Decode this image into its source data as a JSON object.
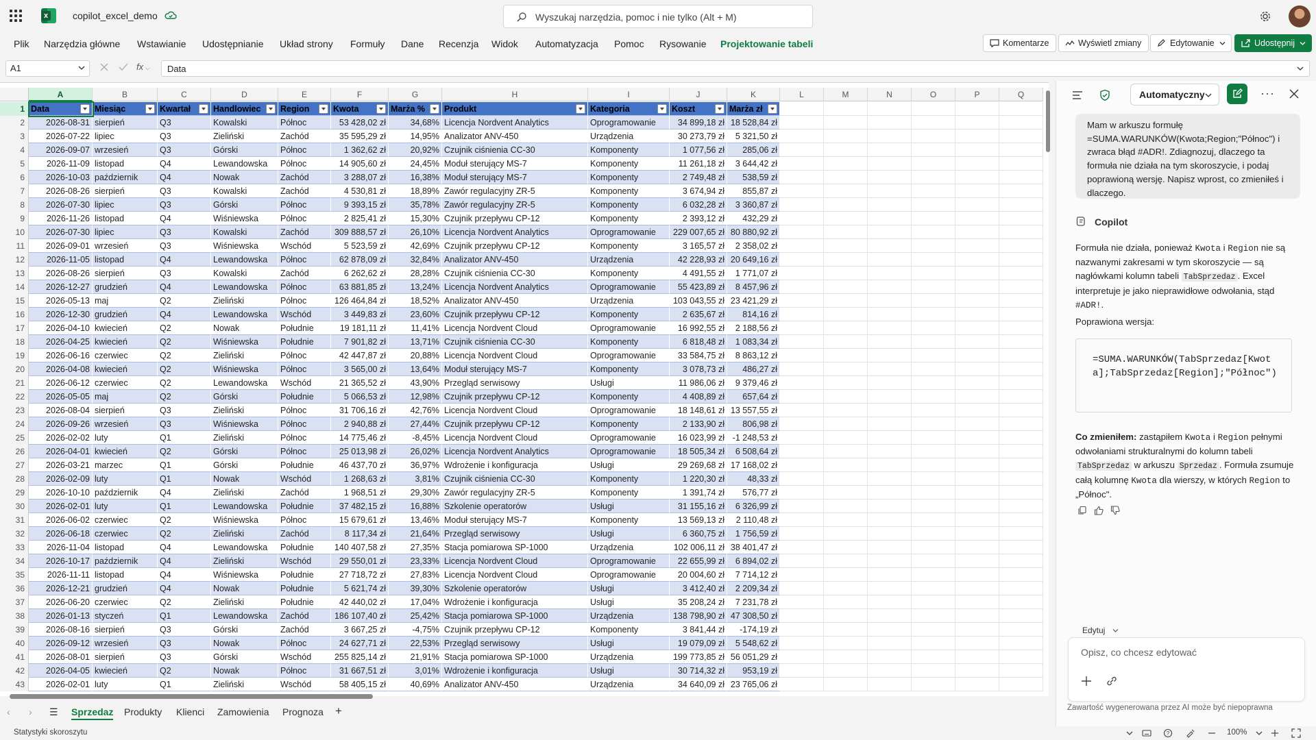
{
  "title_bar": {
    "doc_title": "copilot_excel_demo",
    "search_placeholder": "Wyszukaj narzędzia, pomoc i nie tylko (Alt + M)"
  },
  "ribbon": {
    "tabs": [
      "Plik",
      "Narzędzia główne",
      "Wstawianie",
      "Udostępnianie",
      "Układ strony",
      "Formuły",
      "Dane",
      "Recenzja",
      "Widok",
      "Automatyzacja",
      "Pomoc",
      "Rysowanie",
      "Projektowanie tabeli"
    ],
    "active_tab": "Projektowanie tabeli",
    "comments_label": "Komentarze",
    "show_changes_label": "Wyświetl zmiany",
    "editing_label": "Edytowanie",
    "share_label": "Udostępnij"
  },
  "formula_bar": {
    "name_box": "A1",
    "fx": "fx",
    "formula": "Data"
  },
  "grid": {
    "columns": [
      "A",
      "B",
      "C",
      "D",
      "E",
      "F",
      "G",
      "H",
      "I",
      "J",
      "K",
      "L",
      "M",
      "N",
      "O",
      "P",
      "Q"
    ],
    "table_headers": [
      "Data",
      "Miesiąc",
      "Kwartał",
      "Handlowiec",
      "Region",
      "Kwota",
      "Marża %",
      "Produkt",
      "Kategoria",
      "Koszt",
      "Marża zł"
    ],
    "rows": [
      [
        "2026-08-31",
        "sierpień",
        "Q3",
        "Kowalski",
        "Północ",
        "53 428,02 zł",
        "34,68%",
        "Licencja Nordvent Analytics",
        "Oprogramowanie",
        "34 899,18 zł",
        "18 528,84 zł"
      ],
      [
        "2026-07-22",
        "lipiec",
        "Q3",
        "Zieliński",
        "Zachód",
        "35 595,29 zł",
        "14,95%",
        "Analizator ANV-450",
        "Urządzenia",
        "30 273,79 zł",
        "5 321,50 zł"
      ],
      [
        "2026-09-07",
        "wrzesień",
        "Q3",
        "Górski",
        "Północ",
        "1 362,62 zł",
        "20,92%",
        "Czujnik ciśnienia CC-30",
        "Komponenty",
        "1 077,56 zł",
        "285,06 zł"
      ],
      [
        "2026-11-09",
        "listopad",
        "Q4",
        "Lewandowska",
        "Północ",
        "14 905,60 zł",
        "24,45%",
        "Moduł sterujący MS-7",
        "Komponenty",
        "11 261,18 zł",
        "3 644,42 zł"
      ],
      [
        "2026-10-03",
        "październik",
        "Q4",
        "Nowak",
        "Zachód",
        "3 288,07 zł",
        "16,38%",
        "Moduł sterujący MS-7",
        "Komponenty",
        "2 749,48 zł",
        "538,59 zł"
      ],
      [
        "2026-08-26",
        "sierpień",
        "Q3",
        "Kowalski",
        "Zachód",
        "4 530,81 zł",
        "18,89%",
        "Zawór regulacyjny ZR-5",
        "Komponenty",
        "3 674,94 zł",
        "855,87 zł"
      ],
      [
        "2026-07-30",
        "lipiec",
        "Q3",
        "Górski",
        "Północ",
        "9 393,15 zł",
        "35,78%",
        "Zawór regulacyjny ZR-5",
        "Komponenty",
        "6 032,28 zł",
        "3 360,87 zł"
      ],
      [
        "2026-11-26",
        "listopad",
        "Q4",
        "Wiśniewska",
        "Północ",
        "2 825,41 zł",
        "15,30%",
        "Czujnik przepływu CP-12",
        "Komponenty",
        "2 393,12 zł",
        "432,29 zł"
      ],
      [
        "2026-07-30",
        "lipiec",
        "Q3",
        "Kowalski",
        "Zachód",
        "309 888,57 zł",
        "26,10%",
        "Licencja Nordvent Analytics",
        "Oprogramowanie",
        "229 007,65 zł",
        "80 880,92 zł"
      ],
      [
        "2026-09-01",
        "wrzesień",
        "Q3",
        "Wiśniewska",
        "Wschód",
        "5 523,59 zł",
        "42,69%",
        "Czujnik przepływu CP-12",
        "Komponenty",
        "3 165,57 zł",
        "2 358,02 zł"
      ],
      [
        "2026-11-05",
        "listopad",
        "Q4",
        "Lewandowska",
        "Północ",
        "62 878,09 zł",
        "32,84%",
        "Analizator ANV-450",
        "Urządzenia",
        "42 228,93 zł",
        "20 649,16 zł"
      ],
      [
        "2026-08-26",
        "sierpień",
        "Q3",
        "Kowalski",
        "Zachód",
        "6 262,62 zł",
        "28,28%",
        "Czujnik ciśnienia CC-30",
        "Komponenty",
        "4 491,55 zł",
        "1 771,07 zł"
      ],
      [
        "2026-12-27",
        "grudzień",
        "Q4",
        "Lewandowska",
        "Północ",
        "63 881,85 zł",
        "13,24%",
        "Licencja Nordvent Analytics",
        "Oprogramowanie",
        "55 423,89 zł",
        "8 457,96 zł"
      ],
      [
        "2026-05-13",
        "maj",
        "Q2",
        "Zieliński",
        "Północ",
        "126 464,84 zł",
        "18,52%",
        "Analizator ANV-450",
        "Urządzenia",
        "103 043,55 zł",
        "23 421,29 zł"
      ],
      [
        "2026-12-30",
        "grudzień",
        "Q4",
        "Lewandowska",
        "Wschód",
        "3 449,83 zł",
        "23,60%",
        "Czujnik przepływu CP-12",
        "Komponenty",
        "2 635,67 zł",
        "814,16 zł"
      ],
      [
        "2026-04-10",
        "kwiecień",
        "Q2",
        "Nowak",
        "Południe",
        "19 181,11 zł",
        "11,41%",
        "Licencja Nordvent Cloud",
        "Oprogramowanie",
        "16 992,55 zł",
        "2 188,56 zł"
      ],
      [
        "2026-04-25",
        "kwiecień",
        "Q2",
        "Wiśniewska",
        "Południe",
        "7 901,82 zł",
        "13,71%",
        "Czujnik ciśnienia CC-30",
        "Komponenty",
        "6 818,48 zł",
        "1 083,34 zł"
      ],
      [
        "2026-06-16",
        "czerwiec",
        "Q2",
        "Zieliński",
        "Północ",
        "42 447,87 zł",
        "20,88%",
        "Licencja Nordvent Cloud",
        "Oprogramowanie",
        "33 584,75 zł",
        "8 863,12 zł"
      ],
      [
        "2026-04-08",
        "kwiecień",
        "Q2",
        "Wiśniewska",
        "Północ",
        "3 565,00 zł",
        "13,64%",
        "Moduł sterujący MS-7",
        "Komponenty",
        "3 078,73 zł",
        "486,27 zł"
      ],
      [
        "2026-06-12",
        "czerwiec",
        "Q2",
        "Lewandowska",
        "Wschód",
        "21 365,52 zł",
        "43,90%",
        "Przegląd serwisowy",
        "Usługi",
        "11 986,06 zł",
        "9 379,46 zł"
      ],
      [
        "2026-05-05",
        "maj",
        "Q2",
        "Górski",
        "Południe",
        "5 066,53 zł",
        "12,98%",
        "Czujnik przepływu CP-12",
        "Komponenty",
        "4 408,89 zł",
        "657,64 zł"
      ],
      [
        "2026-08-04",
        "sierpień",
        "Q3",
        "Zieliński",
        "Północ",
        "31 706,16 zł",
        "42,76%",
        "Licencja Nordvent Cloud",
        "Oprogramowanie",
        "18 148,61 zł",
        "13 557,55 zł"
      ],
      [
        "2026-09-26",
        "wrzesień",
        "Q3",
        "Wiśniewska",
        "Północ",
        "2 940,88 zł",
        "27,44%",
        "Czujnik przepływu CP-12",
        "Komponenty",
        "2 133,90 zł",
        "806,98 zł"
      ],
      [
        "2026-02-02",
        "luty",
        "Q1",
        "Zieliński",
        "Północ",
        "14 775,46 zł",
        "-8,45%",
        "Licencja Nordvent Cloud",
        "Oprogramowanie",
        "16 023,99 zł",
        "-1 248,53 zł"
      ],
      [
        "2026-04-01",
        "kwiecień",
        "Q2",
        "Górski",
        "Północ",
        "25 013,98 zł",
        "26,02%",
        "Licencja Nordvent Analytics",
        "Oprogramowanie",
        "18 505,34 zł",
        "6 508,64 zł"
      ],
      [
        "2026-03-21",
        "marzec",
        "Q1",
        "Górski",
        "Południe",
        "46 437,70 zł",
        "36,97%",
        "Wdrożenie i konfiguracja",
        "Usługi",
        "29 269,68 zł",
        "17 168,02 zł"
      ],
      [
        "2026-02-09",
        "luty",
        "Q1",
        "Nowak",
        "Wschód",
        "1 268,63 zł",
        "3,81%",
        "Czujnik ciśnienia CC-30",
        "Komponenty",
        "1 220,30 zł",
        "48,33 zł"
      ],
      [
        "2026-10-10",
        "październik",
        "Q4",
        "Zieliński",
        "Zachód",
        "1 968,51 zł",
        "29,30%",
        "Zawór regulacyjny ZR-5",
        "Komponenty",
        "1 391,74 zł",
        "576,77 zł"
      ],
      [
        "2026-02-01",
        "luty",
        "Q1",
        "Lewandowska",
        "Południe",
        "37 482,15 zł",
        "16,88%",
        "Szkolenie operatorów",
        "Usługi",
        "31 155,16 zł",
        "6 326,99 zł"
      ],
      [
        "2026-06-02",
        "czerwiec",
        "Q2",
        "Wiśniewska",
        "Północ",
        "15 679,61 zł",
        "13,46%",
        "Moduł sterujący MS-7",
        "Komponenty",
        "13 569,13 zł",
        "2 110,48 zł"
      ],
      [
        "2026-06-18",
        "czerwiec",
        "Q2",
        "Zieliński",
        "Zachód",
        "8 117,34 zł",
        "21,64%",
        "Przegląd serwisowy",
        "Usługi",
        "6 360,75 zł",
        "1 756,59 zł"
      ],
      [
        "2026-11-04",
        "listopad",
        "Q4",
        "Lewandowska",
        "Południe",
        "140 407,58 zł",
        "27,35%",
        "Stacja pomiarowa SP-1000",
        "Urządzenia",
        "102 006,11 zł",
        "38 401,47 zł"
      ],
      [
        "2026-10-17",
        "październik",
        "Q4",
        "Zieliński",
        "Wschód",
        "29 550,01 zł",
        "23,33%",
        "Licencja Nordvent Cloud",
        "Oprogramowanie",
        "22 655,99 zł",
        "6 894,02 zł"
      ],
      [
        "2026-11-11",
        "listopad",
        "Q4",
        "Wiśniewska",
        "Południe",
        "27 718,72 zł",
        "27,83%",
        "Licencja Nordvent Cloud",
        "Oprogramowanie",
        "20 004,60 zł",
        "7 714,12 zł"
      ],
      [
        "2026-12-21",
        "grudzień",
        "Q4",
        "Nowak",
        "Południe",
        "5 621,74 zł",
        "39,30%",
        "Szkolenie operatorów",
        "Usługi",
        "3 412,40 zł",
        "2 209,34 zł"
      ],
      [
        "2026-06-20",
        "czerwiec",
        "Q2",
        "Zieliński",
        "Południe",
        "42 440,02 zł",
        "17,04%",
        "Wdrożenie i konfiguracja",
        "Usługi",
        "35 208,24 zł",
        "7 231,78 zł"
      ],
      [
        "2026-01-13",
        "styczeń",
        "Q1",
        "Lewandowska",
        "Zachód",
        "186 107,40 zł",
        "25,42%",
        "Stacja pomiarowa SP-1000",
        "Urządzenia",
        "138 798,90 zł",
        "47 308,50 zł"
      ],
      [
        "2026-08-16",
        "sierpień",
        "Q3",
        "Górski",
        "Zachód",
        "3 667,25 zł",
        "-4,75%",
        "Czujnik przepływu CP-12",
        "Komponenty",
        "3 841,44 zł",
        "-174,19 zł"
      ],
      [
        "2026-09-12",
        "wrzesień",
        "Q3",
        "Nowak",
        "Północ",
        "24 627,71 zł",
        "22,53%",
        "Przegląd serwisowy",
        "Usługi",
        "19 079,09 zł",
        "5 548,62 zł"
      ],
      [
        "2026-08-01",
        "sierpień",
        "Q3",
        "Górski",
        "Wschód",
        "255 825,14 zł",
        "21,91%",
        "Stacja pomiarowa SP-1000",
        "Urządzenia",
        "199 773,85 zł",
        "56 051,29 zł"
      ],
      [
        "2026-04-05",
        "kwiecień",
        "Q2",
        "Nowak",
        "Północ",
        "31 667,51 zł",
        "3,01%",
        "Wdrożenie i konfiguracja",
        "Usługi",
        "30 714,32 zł",
        "953,19 zł"
      ],
      [
        "2026-02-01",
        "luty",
        "Q1",
        "Zieliński",
        "Wschód",
        "58 405,15 zł",
        "40,69%",
        "Analizator ANV-450",
        "Urządzenia",
        "34 640,09 zł",
        "23 765,06 zł"
      ]
    ]
  },
  "sheet_tabs": {
    "tabs": [
      "Sprzedaz",
      "Produkty",
      "Klienci",
      "Zamowienia",
      "Prognoza"
    ],
    "active": "Sprzedaz"
  },
  "status_bar": {
    "text": "Statystyki skoroszytu",
    "zoom": "100%"
  },
  "copilot": {
    "mode": "Automatyczny",
    "user_message": "Mam w arkuszu formułę =SUMA.WARUNKÓW(Kwota;Region;\"Północ\") i zwraca błąd #ADR!. Zdiagnozuj, dlaczego ta formuła nie działa na tym skoroszycie, i podaj poprawioną wersję. Napisz wprost, co zmieniłeś i dlaczego.",
    "brand": "Copilot",
    "p1": {
      "a": "Formuła nie działa, ponieważ ",
      "k1": "Kwota",
      "b": " i ",
      "k2": "Region",
      "c": " nie są nazwanymi zakresami w tym skoroszycie — są nagłówkami kolumn tabeli ",
      "chip": "TabSprzedaz",
      "d": ". Excel interpretuje je jako nieprawidłowe odwołania, stąd ",
      "k3": "#ADR!",
      "e": "."
    },
    "corrected_label": "Poprawiona wersja:",
    "code": "=SUMA.WARUNKÓW(TabSprzedaz[Kwota];TabSprzedaz[Region];\"Północ\")",
    "p2": {
      "bold": "Co zmieniłem:",
      "a": " zastąpiłem ",
      "k1": "Kwota",
      "b": " i ",
      "k2": "Region",
      "c": " pełnymi odwołaniami strukturalnymi do kolumn tabeli ",
      "chip1": "TabSprzedaz",
      "d": " w arkuszu ",
      "chip2": "Sprzedaz",
      "e": ". Formuła zsumuje całą kolumnę ",
      "k3": "Kwota",
      "f": " dla wierszy, w których ",
      "k4": "Region",
      "g": " to „Północ\"."
    },
    "edit_mode_label": "Edytuj",
    "input_placeholder": "Opisz, co chcesz edytować",
    "disclaimer": "Zawartość wygenerowana przez AI może być niepoprawna"
  }
}
